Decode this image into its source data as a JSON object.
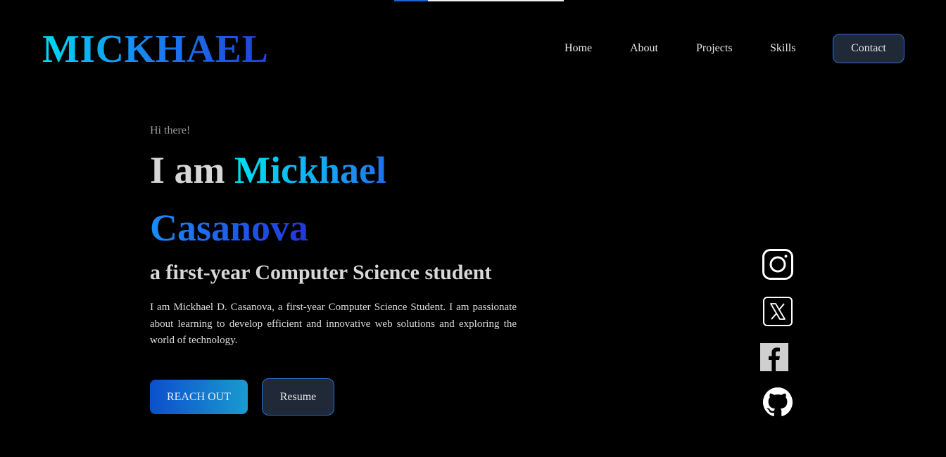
{
  "scroll_progress": 0.2,
  "logo": "MICKHAEL",
  "nav": {
    "home": "Home",
    "about": "About",
    "projects": "Projects",
    "skills": "Skills",
    "contact": "Contact"
  },
  "hero": {
    "greeting": "Hi there!",
    "headline_prefix": "I am",
    "first_name": "Mickhael",
    "last_name": "Casanova",
    "subtitle": "a first-year Computer Science student",
    "bio": "I am Mickhael D. Casanova, a first-year Computer Science Student. I am passionate about learning to develop efficient and innovative web solutions and exploring the world of technology.",
    "reach_out_label": "REACH OUT",
    "resume_label": "Resume"
  },
  "social_icons": [
    "instagram-icon",
    "x-twitter-icon",
    "facebook-icon",
    "github-icon"
  ],
  "colors": {
    "background": "#000000",
    "accent_cyan": "#00d8f5",
    "accent_blue": "#1f3fdc",
    "button_dark": "#1f2937",
    "button_border": "#2d6fd4"
  }
}
